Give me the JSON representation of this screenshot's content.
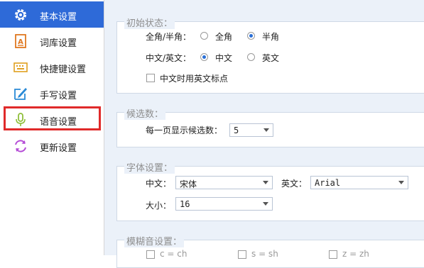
{
  "sidebar": {
    "items": [
      {
        "label": "基本设置",
        "icon": "gear-icon"
      },
      {
        "label": "词库设置",
        "icon": "dictionary-icon"
      },
      {
        "label": "快捷键设置",
        "icon": "keyboard-icon"
      },
      {
        "label": "手写设置",
        "icon": "pen-icon"
      },
      {
        "label": "语音设置",
        "icon": "microphone-icon"
      },
      {
        "label": "更新设置",
        "icon": "refresh-icon"
      }
    ],
    "active_index": 0,
    "highlight_index": 4
  },
  "initial_state": {
    "title": "初始状态：",
    "width_label": "全角/半角：",
    "full_width": "全角",
    "half_width": "半角",
    "width_selected": "半角",
    "lang_label": "中文/英文：",
    "chinese": "中文",
    "english": "英文",
    "lang_selected": "中文",
    "punct_checkbox": "中文时用英文标点",
    "punct_checked": false
  },
  "candidates": {
    "title": "候选数：",
    "per_page_label": "每一页显示候选数：",
    "per_page_value": "5"
  },
  "font": {
    "title": "字体设置：",
    "chinese_label": "中文：",
    "chinese_value": "宋体",
    "english_label": "英文：",
    "english_value": "Arial",
    "size_label": "大小：",
    "size_value": "16"
  },
  "fuzzy": {
    "title": "模糊音设置：",
    "options": [
      "c = ch",
      "s = sh",
      "z = zh"
    ]
  },
  "colors": {
    "accent": "#2e6ad8",
    "highlight": "#e02a2a",
    "panel_bg": "#ebf1f9"
  }
}
